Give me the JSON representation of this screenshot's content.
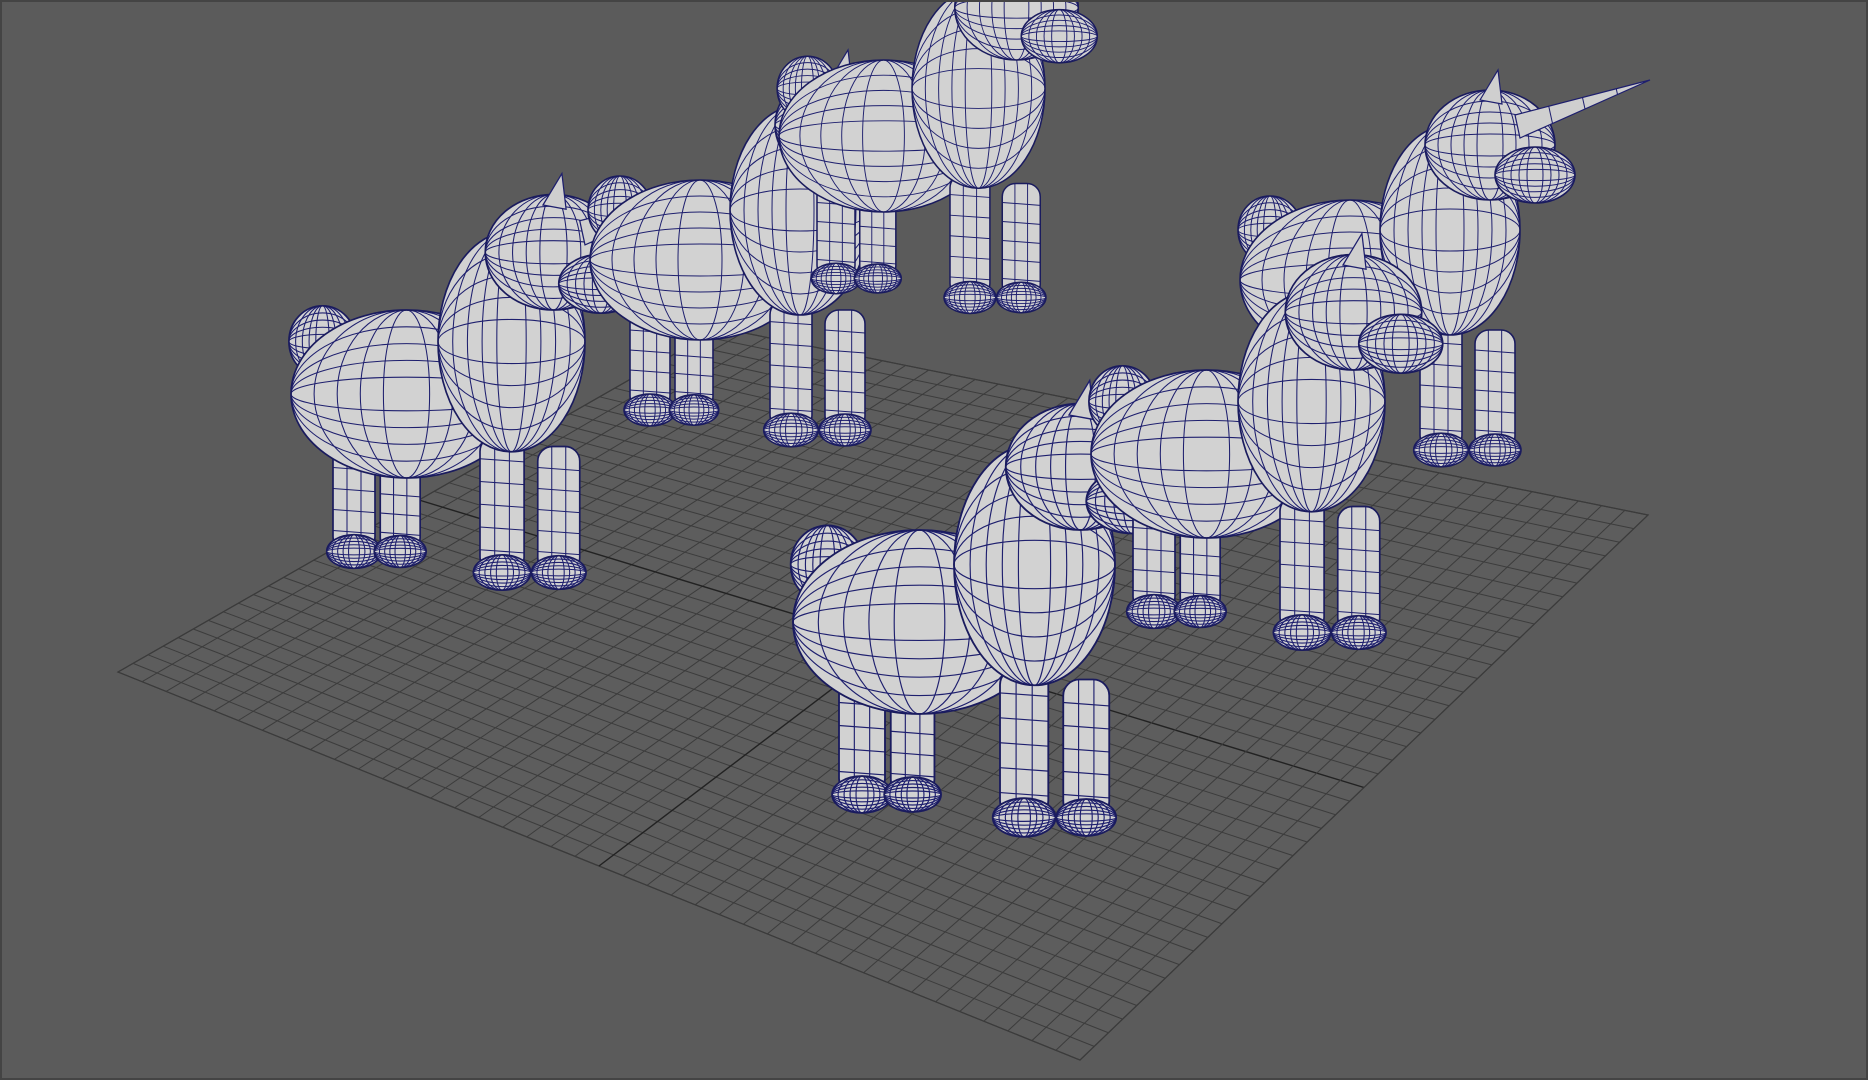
{
  "viewport": {
    "background": "#5b5b5b",
    "grid_color": "#3c3c3c",
    "wire_color": "#1e1f6e",
    "mesh_color": "#d2d2d2",
    "grid_divisions": 40,
    "display_mode": "wireframe-on-shaded"
  },
  "scene": {
    "object_count": 6,
    "objects": [
      {
        "name": "unicorn-front-center",
        "has_horn": false
      },
      {
        "name": "unicorn-left",
        "has_horn": true
      },
      {
        "name": "unicorn-back-left",
        "has_horn": true
      },
      {
        "name": "unicorn-back-center",
        "has_horn": true
      },
      {
        "name": "unicorn-right",
        "has_horn": true
      },
      {
        "name": "unicorn-middle-right",
        "has_horn": false
      }
    ]
  }
}
